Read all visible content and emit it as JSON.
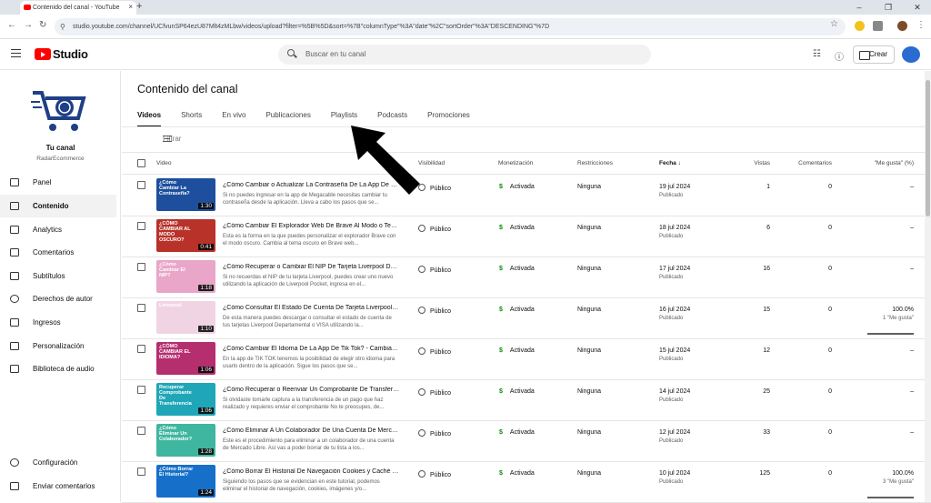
{
  "browser": {
    "tab_title": "Contenido del canal - YouTube",
    "url": "studio.youtube.com/channel/UCfvunSP64ezU87Mlt4zMLbw/videos/upload?filter=%5B%5D&sort=%7B\"columnType\"%3A\"date\"%2C\"sortOrder\"%3A\"DESCENDING\"%7D"
  },
  "topbar": {
    "logo_text": "Studio",
    "search_placeholder": "Buscar en tu canal",
    "create_label": "Crear"
  },
  "sidebar": {
    "channel_title": "Tu canal",
    "channel_name": "RadarEcommerce",
    "items": [
      {
        "label": "Panel",
        "icon": "dashboard-icon"
      },
      {
        "label": "Contenido",
        "icon": "content-icon",
        "active": true
      },
      {
        "label": "Analytics",
        "icon": "analytics-icon"
      },
      {
        "label": "Comentarios",
        "icon": "comments-icon"
      },
      {
        "label": "Subtítulos",
        "icon": "subtitles-icon"
      },
      {
        "label": "Derechos de autor",
        "icon": "copyright-icon"
      },
      {
        "label": "Ingresos",
        "icon": "dollar-icon"
      },
      {
        "label": "Personalización",
        "icon": "customization-icon"
      },
      {
        "label": "Biblioteca de audio",
        "icon": "audio-library-icon"
      }
    ],
    "bottom_items": [
      {
        "label": "Configuración",
        "icon": "gear-icon"
      },
      {
        "label": "Enviar comentarios",
        "icon": "feedback-icon"
      }
    ]
  },
  "main": {
    "title": "Contenido del canal",
    "tabs": [
      "Videos",
      "Shorts",
      "En vivo",
      "Publicaciones",
      "Playlists",
      "Podcasts",
      "Promociones"
    ],
    "filter_placeholder": "Filtrar",
    "columns": {
      "video": "Video",
      "visibility": "Visibilidad",
      "monetization": "Monetización",
      "restrictions": "Restricciones",
      "date": "Fecha",
      "views": "Vistas",
      "comments": "Comentarios",
      "likes": "\"Me gusta\" (%)"
    },
    "rows": [
      {
        "title": "¿Cómo Cambiar o Actualizar La Contraseña De La App De M...",
        "desc": "Si no puedes ingresar en la app de Megacable necesitas cambiar tu contraseña desde la aplicación. Lleva a cabo los pasos que se...",
        "duration": "1:30",
        "thumb_text": "¿Cómo Cambiar La Contraseña?",
        "visibility": "Público",
        "monetization": "Activada",
        "restrictions": "Ninguna",
        "date": "19 jul 2024",
        "status": "Publicado",
        "views": "1",
        "comments": "0",
        "likes": "–",
        "likes_sub": "",
        "thumb_color": "#1d4f9e"
      },
      {
        "title": "¿Cómo Cambiar El Explorador Web De Brave Al Modo o Tema...",
        "desc": "Esta es la forma en la que puedes personalizar el explorador Brave con el modo oscuro. Cambia al tema oscuro en Brave web...",
        "duration": "0:41",
        "thumb_text": "¿CÓMO CAMBIAR AL MODO OSCURO?",
        "visibility": "Público",
        "monetization": "Activada",
        "restrictions": "Ninguna",
        "date": "18 jul 2024",
        "status": "Publicado",
        "views": "6",
        "comments": "0",
        "likes": "–",
        "likes_sub": "",
        "thumb_color": "#b8322a"
      },
      {
        "title": "¿Cómo Recuperar o Cambiar El NIP De Tarjeta Liverpool Dep...",
        "desc": "Si no recuerdas el NIP de tu tarjeta Liverpool, puedes crear uno nuevo utilizando la aplicación de Liverpool Pocket, ingresa en el...",
        "duration": "1:18",
        "thumb_text": "¿Cómo Cambiar El NIP?",
        "visibility": "Público",
        "monetization": "Activada",
        "restrictions": "Ninguna",
        "date": "17 jul 2024",
        "status": "Publicado",
        "views": "16",
        "comments": "0",
        "likes": "–",
        "likes_sub": "",
        "thumb_color": "#e9a6c8"
      },
      {
        "title": "¿Cómo Consultar El Estado De Cuenta De Tarjeta Liverpool D...",
        "desc": "De esta manera puedes descargar o consultar el estado de cuenta de tus tarjetas Liverpool Departamental o VISA utilizando la...",
        "duration": "1:10",
        "thumb_text": "Liverpool",
        "visibility": "Público",
        "monetization": "Activada",
        "restrictions": "Ninguna",
        "date": "16 jul 2024",
        "status": "Publicado",
        "views": "15",
        "comments": "0",
        "likes": "100.0%",
        "likes_sub": "1 \"Me gusta\"",
        "thumb_color": "#f1d4e4"
      },
      {
        "title": "¿Cómo Cambiar El Idioma De La App De Tik Tok? - Cambiar L...",
        "desc": "En la app de TIK TOK tenemos la posibilidad de elegir otro idioma para usarlo dentro de la aplicación. Sigue los pasos que se...",
        "duration": "1:06",
        "thumb_text": "¿CÓMO CAMBIAR EL IDIOMA?",
        "visibility": "Público",
        "monetization": "Activada",
        "restrictions": "Ninguna",
        "date": "15 jul 2024",
        "status": "Publicado",
        "views": "12",
        "comments": "0",
        "likes": "–",
        "likes_sub": "",
        "thumb_color": "#b52e6e"
      },
      {
        "title": "¿Cómo Recuperar o Reenviar Un Comprobante De Transfere...",
        "desc": "Si olvidaste tomarle captura a la transferencia de un pago que haz realizado y requieres enviar el comprobante No te preocupes, de...",
        "duration": "1:06",
        "thumb_text": "Recuperar Comprobante De Transferencia",
        "visibility": "Público",
        "monetization": "Activada",
        "restrictions": "Ninguna",
        "date": "14 jul 2024",
        "status": "Publicado",
        "views": "25",
        "comments": "0",
        "likes": "–",
        "likes_sub": "",
        "thumb_color": "#1fa6b8"
      },
      {
        "title": "¿Cómo Eliminar A Un Colaborador De Una Cuenta De Mercad...",
        "desc": "Este es el procedimiento para eliminar a un colaborador de una cuenta de Mercado Libre. Así vas a poder borrar de tu lista a los...",
        "duration": "1:28",
        "thumb_text": "¿Cómo Eliminar Un Colaborador?",
        "visibility": "Público",
        "monetization": "Activada",
        "restrictions": "Ninguna",
        "date": "12 jul 2024",
        "status": "Publicado",
        "views": "33",
        "comments": "0",
        "likes": "–",
        "likes_sub": "",
        "thumb_color": "#3fb6a0"
      },
      {
        "title": "¿Cómo Borrar El Historial De Navegación Cookies y Caché En...",
        "desc": "Siguiendo los pasos que se evidencian en este tutorial, podemos eliminar el historial de navegación, cookies, imágenes y/o...",
        "duration": "1:24",
        "thumb_text": "¿Cómo Borrar El Historial?",
        "visibility": "Público",
        "monetization": "Activada",
        "restrictions": "Ninguna",
        "date": "10 jul 2024",
        "status": "Publicado",
        "views": "125",
        "comments": "0",
        "likes": "100.0%",
        "likes_sub": "3 \"Me gusta\"",
        "thumb_color": "#1670c9"
      }
    ]
  }
}
